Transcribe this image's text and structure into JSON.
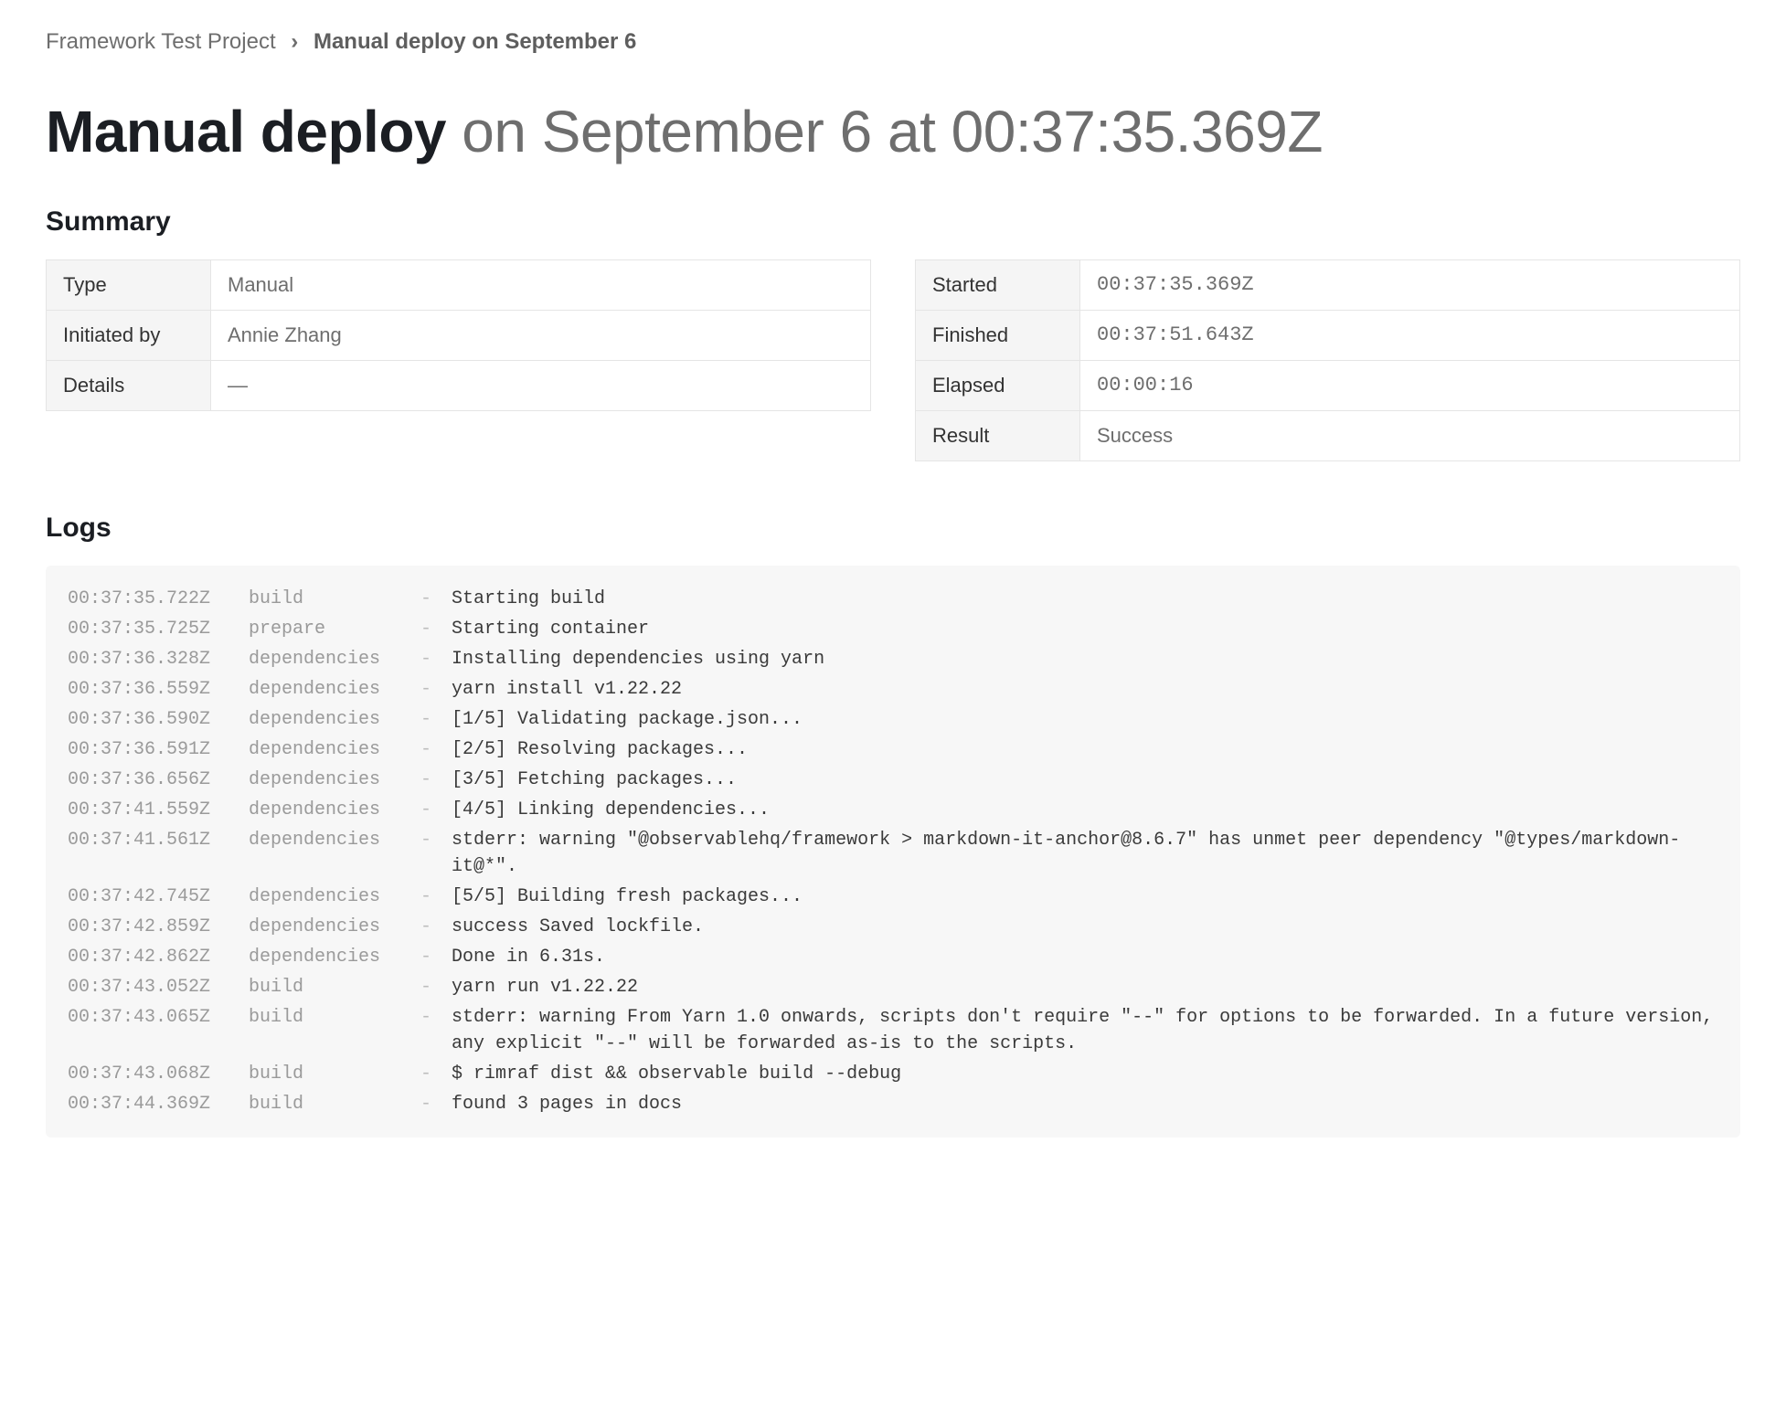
{
  "breadcrumb": {
    "parent": "Framework Test Project",
    "separator": "›",
    "current": "Manual deploy on September 6"
  },
  "title": {
    "strong": "Manual deploy",
    "rest": " on September 6 at 00:37:35.369Z"
  },
  "sections": {
    "summary": "Summary",
    "logs": "Logs"
  },
  "summary": {
    "left": [
      {
        "label": "Type",
        "value": "Manual",
        "mono": false
      },
      {
        "label": "Initiated by",
        "value": "Annie Zhang",
        "mono": false
      },
      {
        "label": "Details",
        "value": "—",
        "mono": false
      }
    ],
    "right": [
      {
        "label": "Started",
        "value": "00:37:35.369Z",
        "mono": true
      },
      {
        "label": "Finished",
        "value": "00:37:51.643Z",
        "mono": true
      },
      {
        "label": "Elapsed",
        "value": "00:00:16",
        "mono": true
      },
      {
        "label": "Result",
        "value": "Success",
        "mono": false
      }
    ]
  },
  "logs": [
    {
      "ts": "00:37:35.722Z",
      "stage": "build",
      "sep": "-",
      "msg": "Starting build"
    },
    {
      "ts": "00:37:35.725Z",
      "stage": "prepare",
      "sep": "-",
      "msg": "Starting container"
    },
    {
      "ts": "00:37:36.328Z",
      "stage": "dependencies",
      "sep": "-",
      "msg": "Installing dependencies using yarn"
    },
    {
      "ts": "00:37:36.559Z",
      "stage": "dependencies",
      "sep": "-",
      "msg": "yarn install v1.22.22"
    },
    {
      "ts": "00:37:36.590Z",
      "stage": "dependencies",
      "sep": "-",
      "msg": "[1/5] Validating package.json..."
    },
    {
      "ts": "00:37:36.591Z",
      "stage": "dependencies",
      "sep": "-",
      "msg": "[2/5] Resolving packages..."
    },
    {
      "ts": "00:37:36.656Z",
      "stage": "dependencies",
      "sep": "-",
      "msg": "[3/5] Fetching packages..."
    },
    {
      "ts": "00:37:41.559Z",
      "stage": "dependencies",
      "sep": "-",
      "msg": "[4/5] Linking dependencies..."
    },
    {
      "ts": "00:37:41.561Z",
      "stage": "dependencies",
      "sep": "-",
      "msg": "stderr: warning \"@observablehq/framework > markdown-it-anchor@8.6.7\" has unmet peer dependency \"@types/markdown-it@*\"."
    },
    {
      "ts": "00:37:42.745Z",
      "stage": "dependencies",
      "sep": "-",
      "msg": "[5/5] Building fresh packages..."
    },
    {
      "ts": "00:37:42.859Z",
      "stage": "dependencies",
      "sep": "-",
      "msg": "success Saved lockfile."
    },
    {
      "ts": "00:37:42.862Z",
      "stage": "dependencies",
      "sep": "-",
      "msg": "Done in 6.31s."
    },
    {
      "ts": "00:37:43.052Z",
      "stage": "build",
      "sep": "-",
      "msg": "yarn run v1.22.22"
    },
    {
      "ts": "00:37:43.065Z",
      "stage": "build",
      "sep": "-",
      "msg": "stderr: warning From Yarn 1.0 onwards, scripts don't require \"--\" for options to be forwarded. In a future version, any explicit \"--\" will be forwarded as-is to the scripts."
    },
    {
      "ts": "00:37:43.068Z",
      "stage": "build",
      "sep": "-",
      "msg": "$ rimraf dist && observable build --debug"
    },
    {
      "ts": "00:37:44.369Z",
      "stage": "build",
      "sep": "-",
      "msg": "found 3 pages in docs"
    }
  ]
}
